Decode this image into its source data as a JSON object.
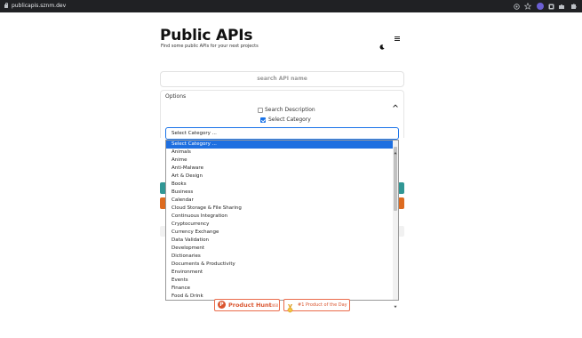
{
  "browser": {
    "url": "publicapis.sznm.dev"
  },
  "header": {
    "title": "Public APIs",
    "subtitle": "Find some public APIs for your next projects"
  },
  "search": {
    "placeholder": "search API name"
  },
  "options": {
    "label": "Options",
    "search_description_label": "Search Description",
    "search_description_checked": false,
    "select_category_label": "Select Category",
    "select_category_checked": true
  },
  "category_select": {
    "value": "Select Category ...",
    "options": [
      "Select Category ...",
      "Animals",
      "Anime",
      "Anti-Malware",
      "Art & Design",
      "Books",
      "Business",
      "Calendar",
      "Cloud Storage & File Sharing",
      "Continuous Integration",
      "Cryptocurrency",
      "Currency Exchange",
      "Data Validation",
      "Development",
      "Dictionaries",
      "Documents & Productivity",
      "Environment",
      "Events",
      "Finance",
      "Food & Drink"
    ]
  },
  "badges": {
    "product_hunt_label": "Product Hunt",
    "product_hunt_count": "1460",
    "product_of_day_label": "#1 Product of the Day"
  },
  "colors": {
    "accent_blue": "#1a73e8",
    "product_hunt": "#da552f",
    "teal_button": "#319795",
    "orange_button": "#dd6b20"
  },
  "icons": {
    "lock": "lock-icon",
    "theme_toggle": "moon-icon",
    "menu": "hamburger-menu-icon",
    "options_toggle": "chevron-up-icon",
    "select_toggle": "chevron-down-icon",
    "product_hunt": "product-hunt-logo-icon",
    "award": "medal-icon"
  }
}
